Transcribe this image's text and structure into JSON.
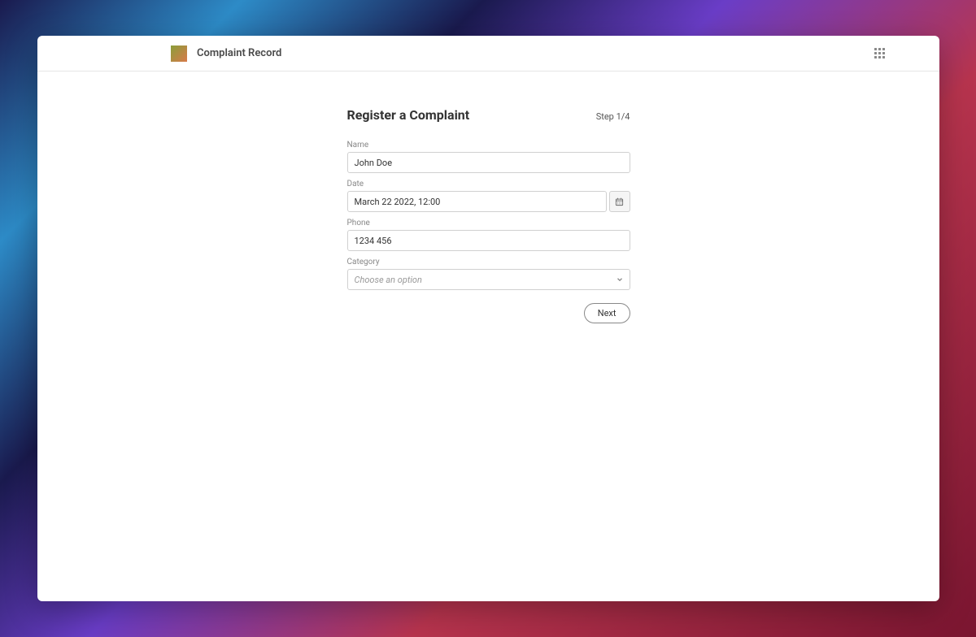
{
  "header": {
    "app_title": "Complaint Record"
  },
  "form": {
    "title": "Register a Complaint",
    "step_indicator": "Step 1/4",
    "fields": {
      "name": {
        "label": "Name",
        "value": "John Doe"
      },
      "date": {
        "label": "Date",
        "value": "March 22 2022, 12:00"
      },
      "phone": {
        "label": "Phone",
        "value": "1234 456"
      },
      "category": {
        "label": "Category",
        "placeholder": "Choose an option"
      }
    },
    "actions": {
      "next_label": "Next"
    }
  }
}
